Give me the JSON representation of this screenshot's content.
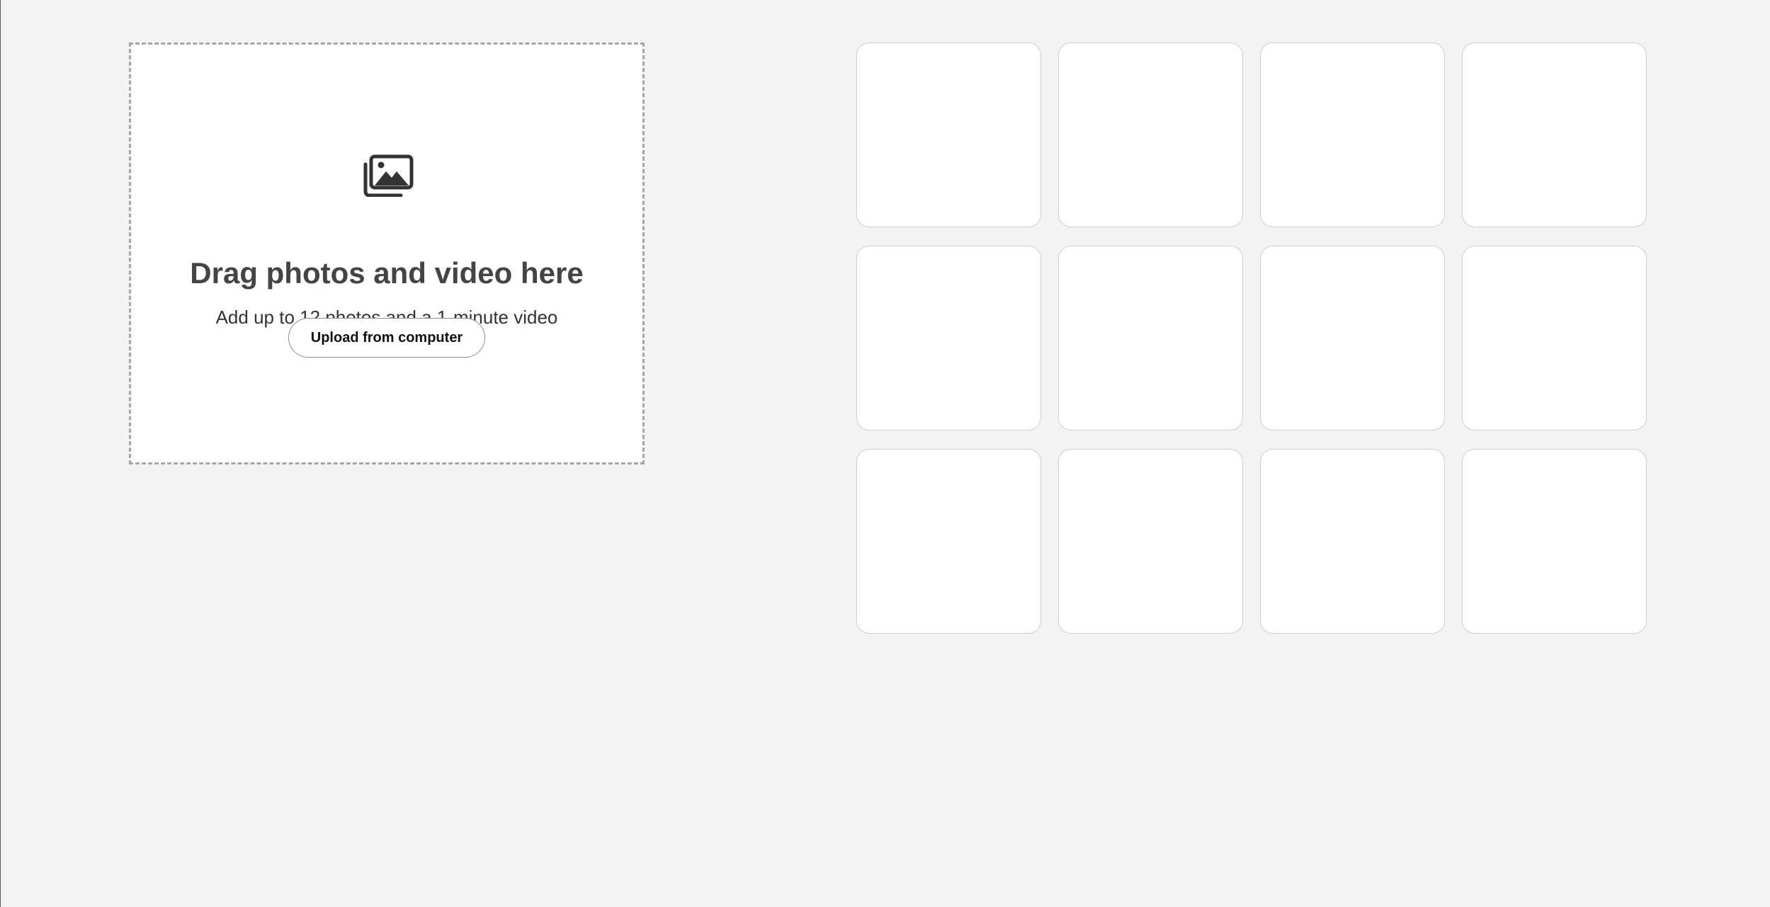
{
  "dropzone": {
    "icon": "photo-gallery-icon",
    "title": "Drag photos and video here",
    "subtitle": "Add up to 12 photos and a 1-minute video",
    "upload_label": "Upload from computer"
  },
  "photo_grid": {
    "slot_count": 12
  },
  "colors": {
    "background": "#f3f3f3",
    "panel": "#ffffff",
    "dashed_border": "#a6a6a6",
    "icon": "#333333",
    "title_text": "#444444"
  }
}
